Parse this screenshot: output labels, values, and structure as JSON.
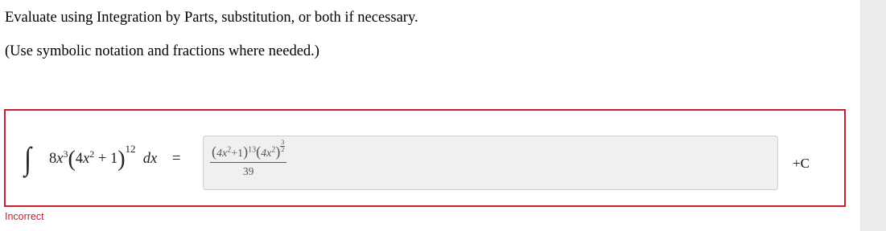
{
  "question": {
    "instruction": "Evaluate using Integration by Parts, substitution, or both if necessary.",
    "note": "(Use symbolic notation and fractions where needed.)"
  },
  "problem": {
    "integral_symbol": "∫",
    "coef": "8",
    "var": "x",
    "power1": "3",
    "open_paren": "(",
    "inner_coef": "4",
    "inner_var": "x",
    "inner_power": "2",
    "inner_rest": " + 1",
    "close_paren": ")",
    "outer_power": "12",
    "differential": "dx",
    "equals": "="
  },
  "answer": {
    "numerator": {
      "term1_base": "4x",
      "term1_sq": "2",
      "term1_rest": "+1",
      "term1_exp": "13",
      "term2_base": "4x",
      "term2_sq": "2",
      "term2_exp_num": "3",
      "term2_exp_den": "2"
    },
    "denominator": "39",
    "constant": "+C"
  },
  "status": {
    "label": "Incorrect",
    "color": "#c81e2a"
  }
}
